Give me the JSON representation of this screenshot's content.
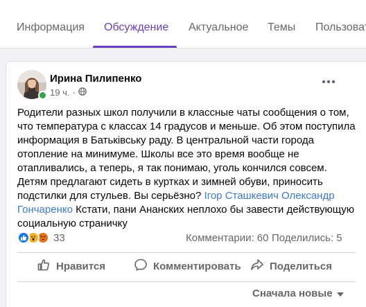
{
  "tabs": [
    {
      "label": "Информация",
      "active": false
    },
    {
      "label": "Обсуждение",
      "active": true
    },
    {
      "label": "Актуальное",
      "active": false
    },
    {
      "label": "Темы",
      "active": false
    },
    {
      "label": "Пользовате",
      "active": false
    }
  ],
  "post": {
    "author": "Ирина Пилипенко",
    "time": "19 ч.",
    "audience_icon": "globe-icon",
    "text_segments": [
      {
        "text": "Родители разных школ получили в классные чаты сообщения о том, что температура с классах 14 градусов и меньше. Об этом поступила информация в Батьківську раду. В центральной части города отопление на минимуме. Школы все это время вообще не отапливались, а теперь, я так понимаю, уголь кончился совсем. Детям предлагают сидеть в куртках и зимней обуви, приносить подстилки для стульев. Вы серьёзно? ",
        "mention": false
      },
      {
        "text": "Ігор Сташкевич",
        "mention": true
      },
      {
        "text": " ",
        "mention": false
      },
      {
        "text": "Олександр Гончаренко",
        "mention": true
      },
      {
        "text": " Кстати, пани Ананских неплохо бы завести действующую социальную страничку",
        "mention": false
      }
    ],
    "reactions": [
      "like",
      "wow",
      "angry"
    ],
    "reaction_count": "33",
    "comments": "Комментарии: 60",
    "shares": "Поделились: 5"
  },
  "actions": {
    "like": "Нравится",
    "comment": "Комментировать",
    "share": "Поделиться"
  },
  "sort": {
    "label": "Сначала новые"
  },
  "colors": {
    "accent": "#6a3fbf",
    "mention": "#3b78d8",
    "online": "#31a24c"
  }
}
